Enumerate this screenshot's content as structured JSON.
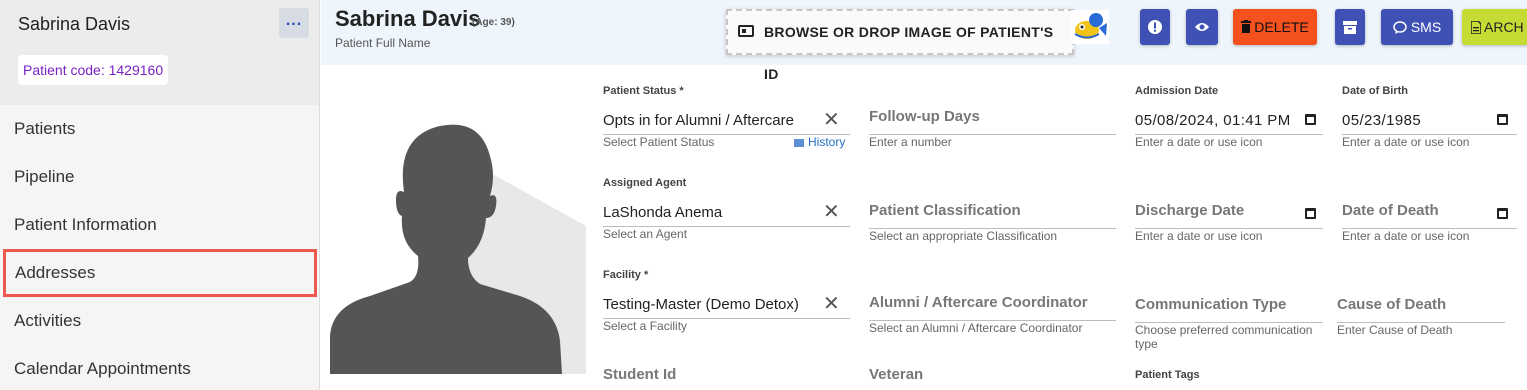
{
  "sidebar": {
    "patient_name": "Sabrina Davis",
    "more_label": "...",
    "patient_code": "Patient code: 1429160",
    "items": [
      {
        "label": "Patients"
      },
      {
        "label": "Pipeline"
      },
      {
        "label": "Patient Information"
      },
      {
        "label": "Addresses"
      },
      {
        "label": "Activities"
      },
      {
        "label": "Calendar Appointments"
      }
    ]
  },
  "header": {
    "name": "Sabrina Davis",
    "age": "(Age: 39)",
    "subtitle": "Patient Full Name",
    "dropzone_label": "BROWSE OR DROP IMAGE OF PATIENT'S ID",
    "buttons": {
      "delete": "DELETE",
      "sms": "SMS",
      "archive": "ARCH"
    }
  },
  "form": {
    "patient_status": {
      "label": "Patient Status *",
      "value": "Opts in for Alumni / Aftercare",
      "help": "Select Patient Status",
      "history": "History"
    },
    "follow_up": {
      "label": "Follow-up Days",
      "help": "Enter a number"
    },
    "admission_date": {
      "label": "Admission Date",
      "value": "05/08/2024, 01:41 PM",
      "help": "Enter a date or use icon"
    },
    "dob": {
      "label": "Date of Birth",
      "value": "05/23/1985",
      "help": "Enter a date or use icon"
    },
    "assigned_agent": {
      "label": "Assigned Agent",
      "value": "LaShonda Anema",
      "help": "Select an Agent"
    },
    "classification": {
      "label": "Patient Classification",
      "help": "Select an appropriate Classification"
    },
    "discharge_date": {
      "label": "Discharge Date",
      "help": "Enter a date or use icon"
    },
    "date_of_death": {
      "label": "Date of Death",
      "help": "Enter a date or use icon"
    },
    "facility": {
      "label": "Facility *",
      "value": "Testing-Master (Demo Detox)",
      "help": "Select a Facility"
    },
    "coordinator": {
      "label": "Alumni / Aftercare Coordinator",
      "help": "Select an Alumni / Aftercare Coordinator"
    },
    "communication": {
      "label": "Communication Type",
      "help": "Choose preferred communication type"
    },
    "cause_of_death": {
      "label": "Cause of Death",
      "help": "Enter Cause of Death"
    },
    "student_id": {
      "label": "Student Id"
    },
    "veteran": {
      "label": "Veteran"
    },
    "patient_tags": {
      "label": "Patient Tags"
    }
  },
  "colors": {
    "accent": "#3f51b5",
    "delete": "#f4511e",
    "archive": "#c6dc35",
    "highlight_border": "#ec5a4f",
    "patient_code": "#7b22c7"
  }
}
